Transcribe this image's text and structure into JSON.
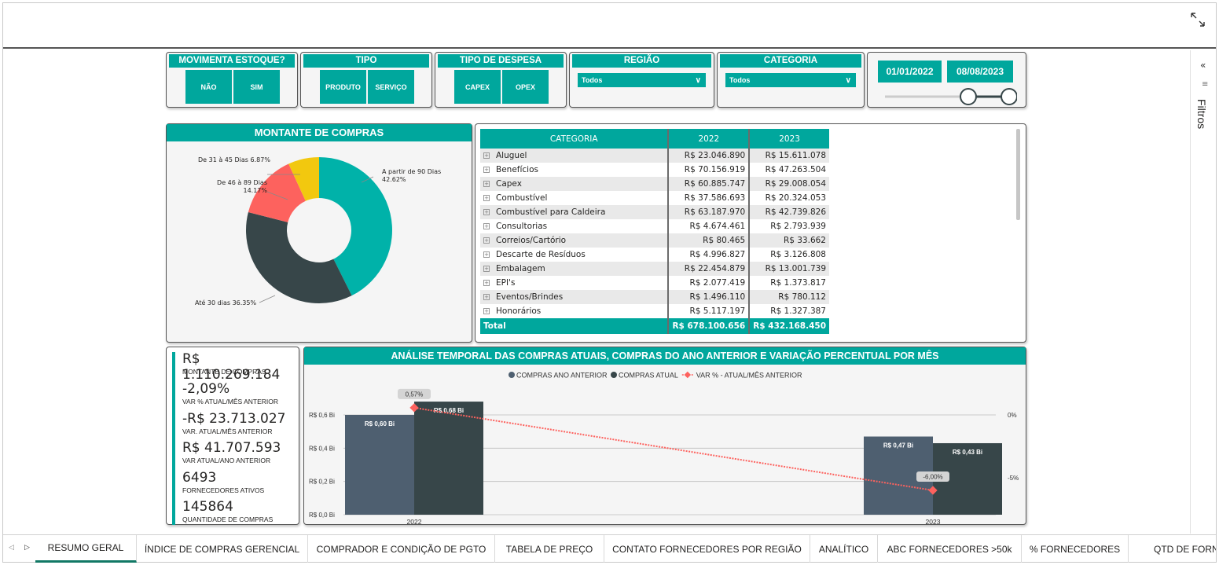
{
  "colors": {
    "teal": "#00A79D",
    "slate": "#4E5F70",
    "dark": "#374649",
    "red": "#FD625E",
    "yellow": "#F2C80F"
  },
  "filters": {
    "movimenta_title": "MOVIMENTA ESTOQUE?",
    "movimenta_opts": [
      "NÃO",
      "SIM"
    ],
    "tipo_title": "TIPO",
    "tipo_opts": [
      "PRODUTO",
      "SERVIÇO"
    ],
    "despesa_title": "TIPO DE DESPESA",
    "despesa_opts": [
      "CAPEX",
      "OPEX"
    ],
    "regiao_title": "REGIÃO",
    "regiao_value": "Todos",
    "categoria_title": "CATEGORIA",
    "categoria_value": "Todos",
    "date_start": "01/01/2022",
    "date_end": "08/08/2023"
  },
  "filters_pane": {
    "label": "Filtros"
  },
  "donut": {
    "title": "MONTANTE DE COMPRAS",
    "labels": {
      "a_partir_90": "A partir de 90 Dias",
      "a_partir_90_pct": "42.62%",
      "de46": "De 46 à 89 Dias",
      "de46_pct": "14.17%",
      "de31": "De 31 à 45 Dias 6.87%",
      "ate30": "Até 30 dias 36.35%"
    },
    "slices": [
      {
        "name": "A partir de 90 Dias",
        "pct": 42.62,
        "color": "#00B2A9"
      },
      {
        "name": "Até 30 dias",
        "pct": 36.35,
        "color": "#374649"
      },
      {
        "name": "De 46 à 89 Dias",
        "pct": 14.17,
        "color": "#FD625E"
      },
      {
        "name": "De 31 à 45 Dias",
        "pct": 6.87,
        "color": "#F2C80F"
      }
    ]
  },
  "matrix": {
    "headers": [
      "CATEGORIA",
      "2022",
      "2023"
    ],
    "rows": [
      [
        "Aluguel",
        "R$ 23.046.890",
        "R$ 15.611.078"
      ],
      [
        "Benefícios",
        "R$ 70.156.919",
        "R$ 47.263.504"
      ],
      [
        "Capex",
        "R$ 60.885.747",
        "R$ 29.008.054"
      ],
      [
        "Combustível",
        "R$ 37.586.693",
        "R$ 20.324.053"
      ],
      [
        "Combustível para Caldeira",
        "R$ 63.187.970",
        "R$ 42.739.826"
      ],
      [
        "Consultorias",
        "R$ 4.674.461",
        "R$ 2.793.939"
      ],
      [
        "Correios/Cartório",
        "R$ 80.465",
        "R$ 33.662"
      ],
      [
        "Descarte de Resíduos",
        "R$ 4.996.827",
        "R$ 3.126.808"
      ],
      [
        "Embalagem",
        "R$ 22.454.879",
        "R$ 13.001.739"
      ],
      [
        "EPI's",
        "R$ 2.077.419",
        "R$ 1.373.817"
      ],
      [
        "Eventos/Brindes",
        "R$ 1.496.110",
        "R$ 780.112"
      ],
      [
        "Honorários",
        "R$ 5.117.197",
        "R$ 1.327.387"
      ]
    ],
    "total": [
      "Total",
      "R$ 678.100.656",
      "R$ 432.168.450"
    ]
  },
  "kpis": [
    {
      "value": "R$ 1.110.269.184",
      "label": "MONTANTE DE COMPRAS"
    },
    {
      "value": "-2,09%",
      "label": "VAR % ATUAL/MÊS ANTERIOR"
    },
    {
      "value": "-R$ 23.713.027",
      "label": "VAR. ATUAL/MÊS ANTERIOR"
    },
    {
      "value": "R$ 41.707.593",
      "label": "VAR ATUAL/ANO ANTERIOR"
    },
    {
      "value": "6493",
      "label": "FORNECEDORES ATIVOS"
    },
    {
      "value": "145864",
      "label": "QUANTIDADE DE COMPRAS"
    }
  ],
  "chart_data": {
    "type": "bar",
    "title": "ANÁLISE TEMPORAL DAS COMPRAS ATUAIS, COMPRAS DO ANO ANTERIOR E VARIAÇÃO PERCENTUAL POR MÊS",
    "categories": [
      "2022",
      "2023"
    ],
    "series": [
      {
        "name": "COMPRAS ANO ANTERIOR",
        "values": [
          0.6,
          0.47
        ],
        "labels": [
          "R$ 0,60 Bi",
          "R$ 0,47 Bi"
        ],
        "color": "#4E5F70"
      },
      {
        "name": "COMPRAS ATUAL",
        "values": [
          0.68,
          0.43
        ],
        "labels": [
          "R$ 0,68 Bi",
          "R$ 0,43 Bi"
        ],
        "color": "#374649"
      },
      {
        "name": "VAR % - ATUAL/MÊS ANTERIOR",
        "type": "line",
        "values": [
          0.57,
          -6.0
        ],
        "labels": [
          "0,57%",
          "-6,00%"
        ],
        "color": "#FD625E"
      }
    ],
    "y_ticks": [
      "R$ 0,6 Bi",
      "R$ 0,4 Bi",
      "R$ 0,2 Bi",
      "R$ 0,0 Bi"
    ],
    "y2_ticks": [
      "0%",
      "-5%"
    ],
    "ylim": [
      0,
      0.6
    ],
    "grid": true,
    "legend": "top-center"
  },
  "tabs": [
    "RESUMO GERAL",
    "ÍNDICE DE COMPRAS GERENCIAL",
    "COMPRADOR E CONDIÇÃO DE PGTO",
    "TABELA DE PREÇO",
    "CONTATO FORNECEDORES POR REGIÃO",
    "ANALÍTICO",
    "ABC FORNECEDORES >50k",
    "% FORNECEDORES",
    "QTD DE FORN"
  ]
}
